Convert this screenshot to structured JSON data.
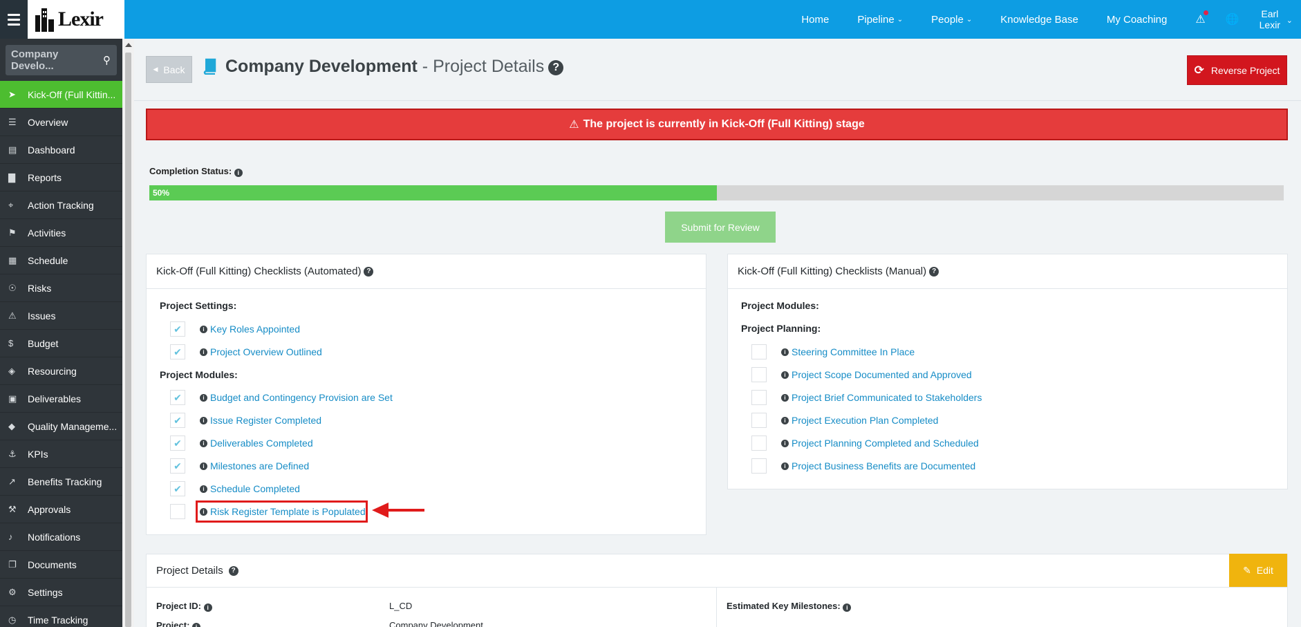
{
  "app": {
    "logo_text": "Lexir"
  },
  "nav": {
    "home": "Home",
    "pipeline": "Pipeline",
    "people": "People",
    "knowledge_base": "Knowledge Base",
    "my_coaching": "My Coaching",
    "user_first": "Earl",
    "user_last": "Lexir"
  },
  "sidebar": {
    "search_value": "Company Develo...",
    "items": [
      {
        "label": "Kick-Off (Full Kittin...",
        "icon": "rocket-icon"
      },
      {
        "label": "Overview",
        "icon": "list-icon"
      },
      {
        "label": "Dashboard",
        "icon": "dashboard-icon"
      },
      {
        "label": "Reports",
        "icon": "bar-chart-icon"
      },
      {
        "label": "Action Tracking",
        "icon": "crosshair-icon"
      },
      {
        "label": "Activities",
        "icon": "bookmark-icon"
      },
      {
        "label": "Schedule",
        "icon": "calendar-icon"
      },
      {
        "label": "Risks",
        "icon": "lightbulb-icon"
      },
      {
        "label": "Issues",
        "icon": "warning-icon"
      },
      {
        "label": "Budget",
        "icon": "dollar-icon"
      },
      {
        "label": "Resourcing",
        "icon": "layers-icon"
      },
      {
        "label": "Deliverables",
        "icon": "truck-icon"
      },
      {
        "label": "Quality Manageme...",
        "icon": "tag-icon"
      },
      {
        "label": "KPIs",
        "icon": "anchor-icon"
      },
      {
        "label": "Benefits Tracking",
        "icon": "line-chart-icon"
      },
      {
        "label": "Approvals",
        "icon": "gavel-icon"
      },
      {
        "label": "Notifications",
        "icon": "bell-icon"
      },
      {
        "label": "Documents",
        "icon": "documents-icon"
      },
      {
        "label": "Settings",
        "icon": "gears-icon"
      },
      {
        "label": "Time Tracking",
        "icon": "clock-icon"
      }
    ]
  },
  "header": {
    "back_label": "Back",
    "title_main": "Company Development",
    "title_sep": " - ",
    "title_sub": "Project Details",
    "reverse_label": "Reverse Project"
  },
  "alert": {
    "text": "The project is currently in Kick-Off (Full Kitting) stage"
  },
  "completion": {
    "label": "Completion Status:",
    "percent": 50,
    "percent_text": "50%"
  },
  "submit_label": "Submit for Review",
  "automated": {
    "title": "Kick-Off (Full Kitting) Checklists (Automated)",
    "settings_title": "Project Settings:",
    "modules_title": "Project Modules:",
    "settings_items": [
      {
        "label": "Key Roles Appointed",
        "checked": true
      },
      {
        "label": "Project Overview Outlined",
        "checked": true
      }
    ],
    "module_items": [
      {
        "label": "Budget and Contingency Provision are Set",
        "checked": true
      },
      {
        "label": "Issue Register Completed",
        "checked": true
      },
      {
        "label": "Deliverables Completed",
        "checked": true
      },
      {
        "label": "Milestones are Defined",
        "checked": true
      },
      {
        "label": "Schedule Completed",
        "checked": true
      },
      {
        "label": "Risk Register Template is Populated",
        "checked": false
      }
    ]
  },
  "manual": {
    "title": "Kick-Off (Full Kitting) Checklists (Manual)",
    "modules_title": "Project Modules:",
    "planning_title": "Project Planning:",
    "items": [
      {
        "label": "Steering Committee In Place",
        "checked": false
      },
      {
        "label": "Project Scope Documented and Approved",
        "checked": false
      },
      {
        "label": "Project Brief Communicated to Stakeholders",
        "checked": false
      },
      {
        "label": "Project Execution Plan Completed",
        "checked": false
      },
      {
        "label": "Project Planning Completed and Scheduled",
        "checked": false
      },
      {
        "label": "Project Business Benefits are Documented",
        "checked": false
      }
    ]
  },
  "details": {
    "title": "Project Details",
    "edit_label": "Edit",
    "project_id_label": "Project ID:",
    "project_id_value": "L_CD",
    "project_label": "Project:",
    "project_value": "Company Development",
    "milestones_label": "Estimated Key Milestones:"
  },
  "colors": {
    "topbar": "#0d9de3",
    "sidebar": "#2f353a",
    "active": "#4dbd30",
    "alert": "#e53c3c",
    "progress": "#5bcb54",
    "reverse": "#d2161e",
    "edit": "#f0b40e",
    "link": "#168cc6"
  }
}
